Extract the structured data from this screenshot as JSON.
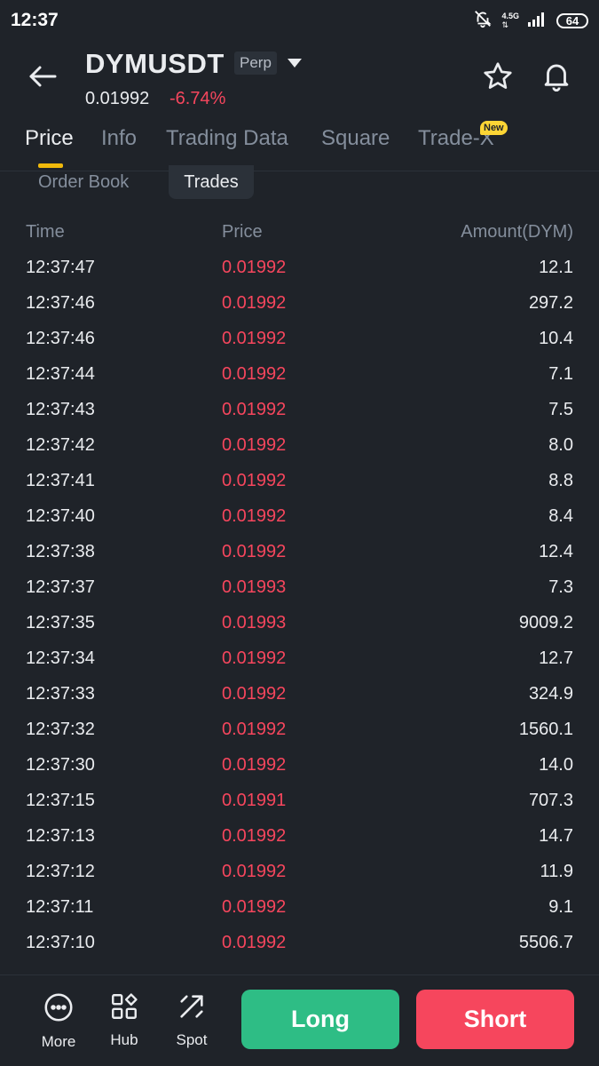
{
  "status_bar": {
    "time": "12:37",
    "network": "4.5G",
    "battery": "64"
  },
  "header": {
    "symbol": "DYMUSDT",
    "contract_type": "Perp",
    "last_price": "0.01992",
    "change_percent": "-6.74%"
  },
  "tabs": {
    "items": [
      "Price",
      "Info",
      "Trading Data",
      "Square",
      "Trade-X"
    ],
    "active": "Price",
    "new_badge": "New"
  },
  "subtabs": {
    "order_book": "Order Book",
    "trades": "Trades"
  },
  "table": {
    "headers": {
      "time": "Time",
      "price": "Price",
      "amount": "Amount(DYM)"
    },
    "rows": [
      {
        "time": "12:37:47",
        "price": "0.01992",
        "amount": "12.1"
      },
      {
        "time": "12:37:46",
        "price": "0.01992",
        "amount": "297.2"
      },
      {
        "time": "12:37:46",
        "price": "0.01992",
        "amount": "10.4"
      },
      {
        "time": "12:37:44",
        "price": "0.01992",
        "amount": "7.1"
      },
      {
        "time": "12:37:43",
        "price": "0.01992",
        "amount": "7.5"
      },
      {
        "time": "12:37:42",
        "price": "0.01992",
        "amount": "8.0"
      },
      {
        "time": "12:37:41",
        "price": "0.01992",
        "amount": "8.8"
      },
      {
        "time": "12:37:40",
        "price": "0.01992",
        "amount": "8.4"
      },
      {
        "time": "12:37:38",
        "price": "0.01992",
        "amount": "12.4"
      },
      {
        "time": "12:37:37",
        "price": "0.01993",
        "amount": "7.3"
      },
      {
        "time": "12:37:35",
        "price": "0.01993",
        "amount": "9009.2"
      },
      {
        "time": "12:37:34",
        "price": "0.01992",
        "amount": "12.7"
      },
      {
        "time": "12:37:33",
        "price": "0.01992",
        "amount": "324.9"
      },
      {
        "time": "12:37:32",
        "price": "0.01992",
        "amount": "1560.1"
      },
      {
        "time": "12:37:30",
        "price": "0.01992",
        "amount": "14.0"
      },
      {
        "time": "12:37:15",
        "price": "0.01991",
        "amount": "707.3"
      },
      {
        "time": "12:37:13",
        "price": "0.01992",
        "amount": "14.7"
      },
      {
        "time": "12:37:12",
        "price": "0.01992",
        "amount": "11.9"
      },
      {
        "time": "12:37:11",
        "price": "0.01992",
        "amount": "9.1"
      },
      {
        "time": "12:37:10",
        "price": "0.01992",
        "amount": "5506.7"
      }
    ]
  },
  "bottom_nav": {
    "more": "More",
    "hub": "Hub",
    "spot": "Spot",
    "long": "Long",
    "short": "Short"
  },
  "colors": {
    "background": "#1f2329",
    "sell_red": "#f6465d",
    "buy_green": "#2ebd85",
    "accent_yellow": "#f0b90b",
    "muted_text": "#848e9c"
  },
  "icons": {
    "back": "arrow-left-icon",
    "favorite": "star-icon",
    "alert": "bell-icon",
    "more": "dots-circle-icon",
    "hub": "grid-icon",
    "spot": "arrows-diagonal-icon"
  }
}
